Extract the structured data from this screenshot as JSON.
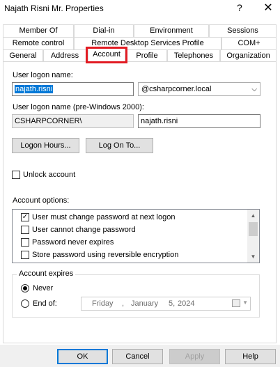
{
  "window": {
    "title": "Najath Risni Mr. Properties",
    "help_glyph": "?",
    "close_glyph": "✕"
  },
  "tabs": {
    "row1": [
      "Member Of",
      "Dial-in",
      "Environment",
      "Sessions"
    ],
    "row2": [
      "Remote control",
      "Remote Desktop Services Profile",
      "COM+"
    ],
    "row3": [
      "General",
      "Address",
      "Account",
      "Profile",
      "Telephones",
      "Organization"
    ],
    "selected": "Account",
    "highlight_color": "#e21b23"
  },
  "account": {
    "logon_name_label": "User logon name:",
    "logon_name_value": "najath.risni",
    "domain_value": "@csharpcorner.local",
    "pre2000_label": "User logon name (pre-Windows 2000):",
    "pre2000_domain": "CSHARPCORNER\\",
    "pre2000_user": "najath.risni",
    "logon_hours_button": "Logon Hours...",
    "logon_to_button": "Log On To...",
    "unlock_label": "Unlock account",
    "unlock_checked": false,
    "options_label": "Account options:",
    "options": [
      {
        "label": "User must change password at next logon",
        "checked": true
      },
      {
        "label": "User cannot change password",
        "checked": false
      },
      {
        "label": "Password never expires",
        "checked": false
      },
      {
        "label": "Store password using reversible encryption",
        "checked": false
      }
    ],
    "expires_label": "Account expires",
    "never_label": "Never",
    "endof_label": "End of:",
    "expires_selected": "Never",
    "date": {
      "weekday": "Friday",
      "sep": ",",
      "month": "January",
      "day": "5,",
      "year": "2024"
    }
  },
  "buttons": {
    "ok": "OK",
    "cancel": "Cancel",
    "apply": "Apply",
    "help": "Help"
  }
}
